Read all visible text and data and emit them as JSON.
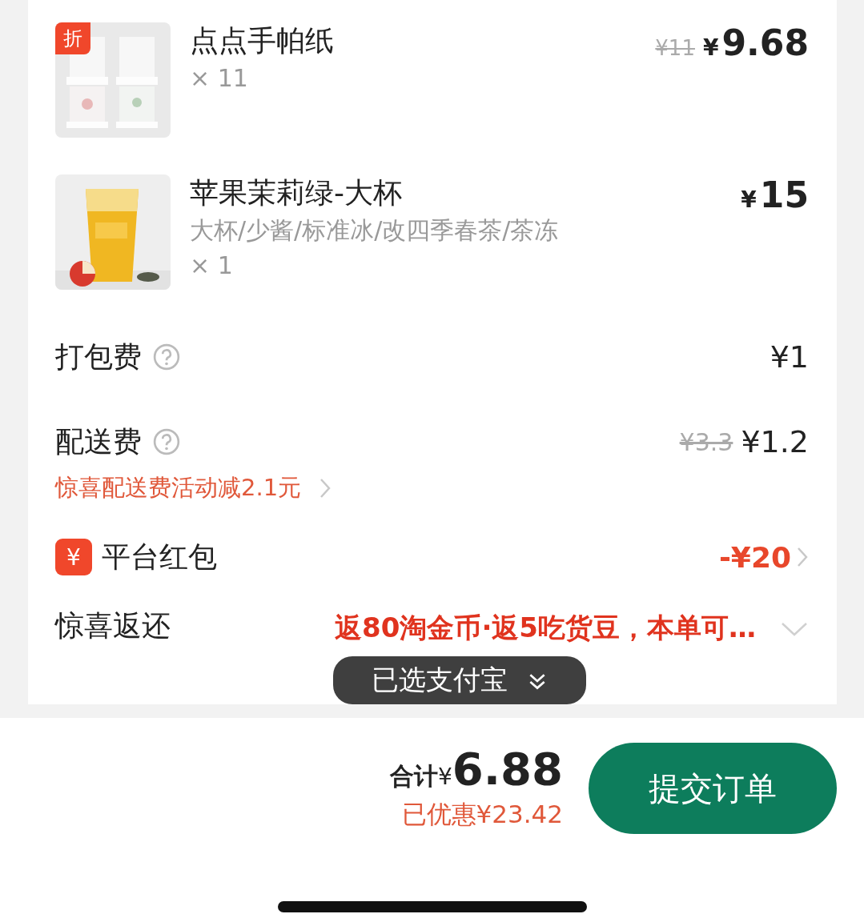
{
  "products": [
    {
      "name": "点点手帕纸",
      "badge": "折",
      "quantity": "× 11",
      "original_price": "¥11",
      "currency": "¥",
      "amount": "9.68"
    },
    {
      "name": "苹果茉莉绿-大杯",
      "options": "大杯/少酱/标准冰/改四季春茶/茶冻",
      "quantity": "× 1",
      "currency": "¥",
      "amount": "15"
    }
  ],
  "fees": [
    {
      "label": "打包费",
      "help": true,
      "price": "¥1"
    },
    {
      "label": "配送费",
      "help": true,
      "original_price": "¥3.3",
      "price": "¥1.2",
      "note": "惊喜配送费活动减2.1元"
    }
  ],
  "platform_packet": {
    "icon": "¥",
    "label": "平台红包",
    "value": "-¥20"
  },
  "surprise_return": {
    "label": "惊喜返还",
    "value": "返80淘金币·返5吃货豆，本单可…"
  },
  "toast": {
    "text": "已选支付宝"
  },
  "footer": {
    "total_label": "合计",
    "currency": "¥",
    "total": "6.88",
    "saved": "已优惠¥23.42",
    "submit": "提交订单"
  }
}
